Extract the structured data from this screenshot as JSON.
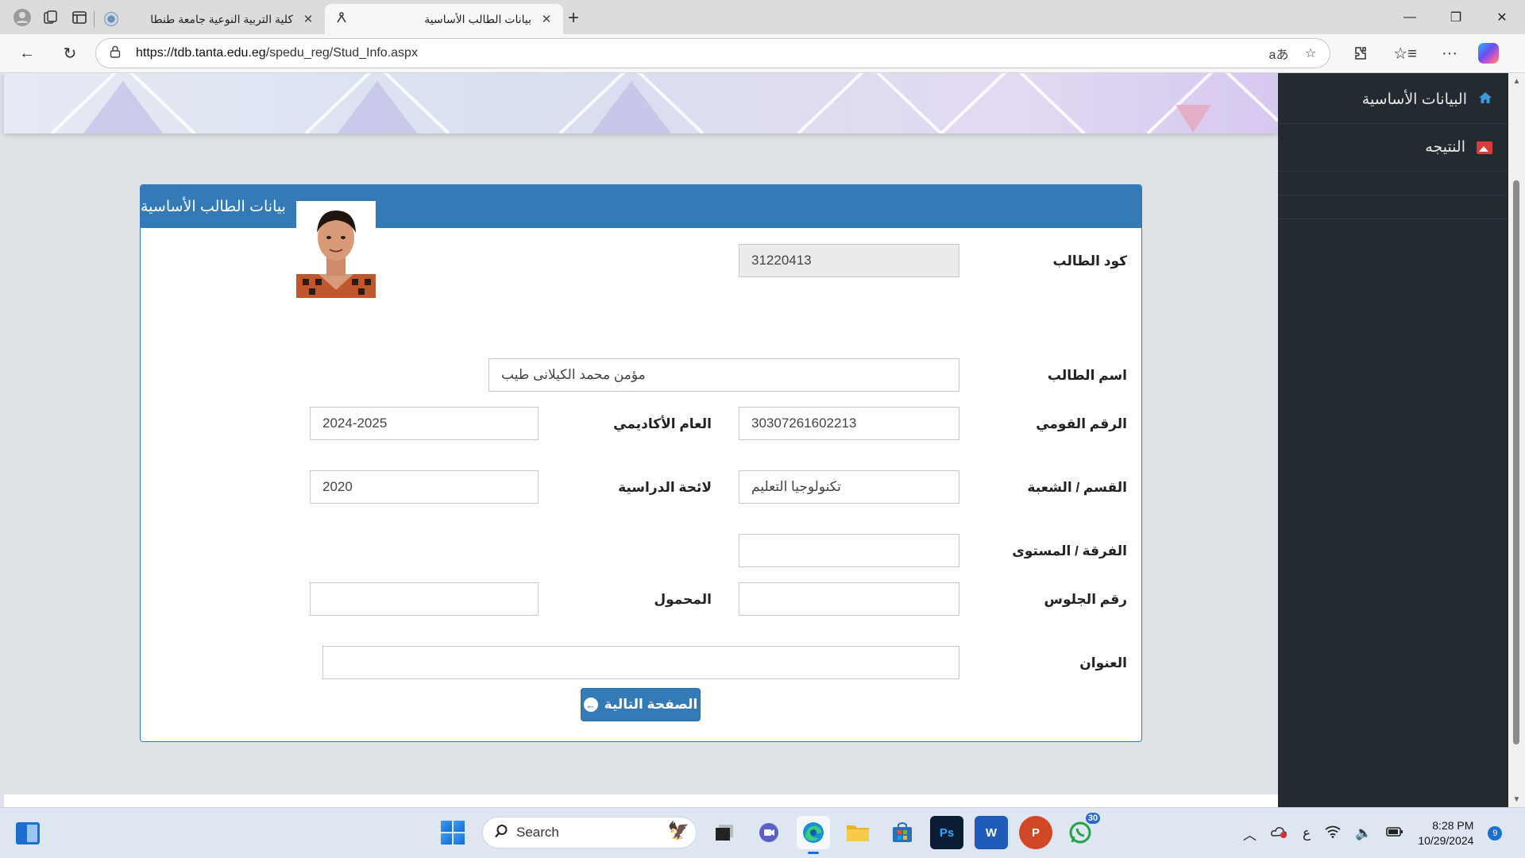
{
  "browser": {
    "tabs": [
      {
        "title": "كلية التربية النوعية جامعة طنطا",
        "active": false
      },
      {
        "title": "بيانات الطالب الأساسية",
        "active": true
      }
    ],
    "new_tab_label": "+",
    "url_host": "https://tdb.tanta.edu.eg",
    "url_path": "/spedu_reg/Stud_Info.aspx",
    "read_aloud_icon_text": "aあ"
  },
  "sidebar": {
    "items": [
      {
        "label": "البيانات الأساسية",
        "icon": "home-icon"
      },
      {
        "label": "النتيجه",
        "icon": "image-icon"
      }
    ]
  },
  "panel": {
    "heading": "بيانات الطالب الأساسية",
    "fields": {
      "student_code": {
        "label": "كود الطالب",
        "value": "31220413"
      },
      "student_name": {
        "label": "اسم الطالب",
        "value": "مؤمن محمد الكيلانى طيب"
      },
      "national_id": {
        "label": "الرقم القومي",
        "value": "30307261602213"
      },
      "academic_year": {
        "label": "العام الأكاديمي",
        "value": "2024-2025"
      },
      "department": {
        "label": "القسم / الشعبة",
        "value": "تكنولوجيا التعليم"
      },
      "regulation": {
        "label": "لائحة الدراسية",
        "value": "2020"
      },
      "level": {
        "label": "الفرقة / المستوى",
        "value": ""
      },
      "seat_number": {
        "label": "رقم الجلوس",
        "value": ""
      },
      "carried": {
        "label": "المحمول",
        "value": ""
      },
      "address": {
        "label": "العنوان",
        "value": ""
      }
    },
    "next_button": "الصفحة التالية"
  },
  "taskbar": {
    "search_placeholder": "Search",
    "whatsapp_badge": "30",
    "input_language": "ع",
    "time": "8:28 PM",
    "date": "10/29/2024",
    "notification_count": "9"
  },
  "colors": {
    "primary": "#337ab7",
    "sidebar_bg": "#232a30",
    "page_bg": "#dfe3e8"
  }
}
